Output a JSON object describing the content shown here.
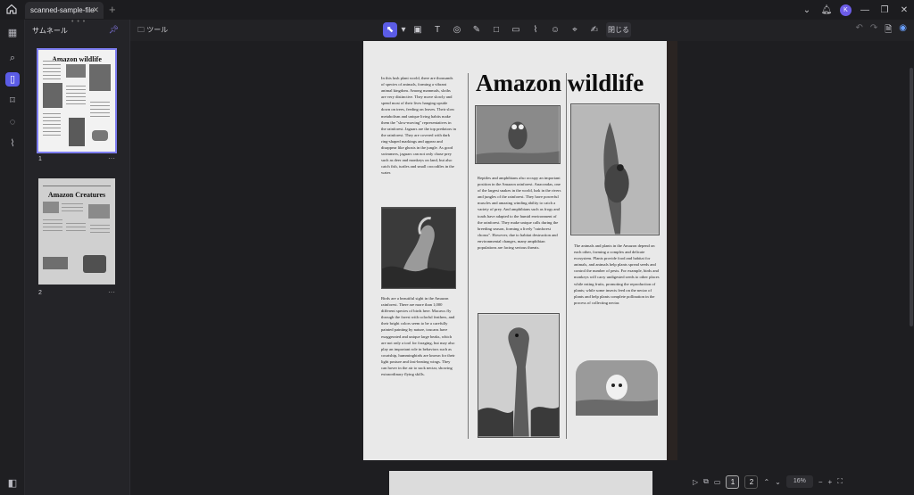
{
  "app": {
    "tab_title": "scanned-sample-file",
    "tab_close": "✕",
    "tab_add": "+",
    "avatar_initial": "K"
  },
  "sidebar": {
    "title": "サムネール",
    "pages": [
      {
        "number": "1",
        "heading": "Amazon wildlife",
        "selected": true
      },
      {
        "number": "2",
        "heading": "Amazon Creatures",
        "selected": false
      }
    ],
    "more": "···"
  },
  "toolbar": {
    "tool_label": "ツール",
    "close_label": "閉じる"
  },
  "document": {
    "title": "Amazon wildlife",
    "col1_top": "In this lush plant world, there are thousands of species of animals, forming a vibrant animal kingdom. Among mammals, sloths are very distinctive. They move slowly and spend most of their lives hanging upside down on trees, feeding on leaves. Their slow metabolism and unique living habits make them the \"slow-moving\" representatives in the rainforest. Jaguars are the top predators in the rainforest. They are covered with dark ring-shaped markings and appear and disappear like ghosts in the jungle. As good swimmers, jaguars can not only chase prey such as deer and monkeys on land, but also catch fish, turtles and small crocodiles in the water.",
    "col1_bottom": "Birds are a beautiful sight in the Amazon rainforest. There are more than 1,000 different species of birds here. Macaws fly through the forest with colorful feathers, and their bright colors seem to be a carefully painted painting by nature, toucans have exaggerated and unique large beaks, which are not only a tool for foraging, but may also play an important role in behaviors such as courtship, hummingbirds are known for their light posture and fast-beating wings. They can hover in the air to suck nectar, showing extraordinary flying skills.",
    "col2": "Reptiles and amphibians also occupy an important position in the Amazon rainforest. Anacondas, one of the largest snakes in the world, lurk in the rivers and jungles of the rainforest. They have powerful muscles and amazing winding ability to catch a variety of prey. And amphibians such as frogs and toads have adapted to the humid environment of the rainforest. They make unique calls during the breeding season, forming a lively \"rainforest chorus\". However, due to habitat destruction and environmental changes, many amphibian populations are facing serious threats.",
    "col3": "The animals and plants in the Amazon depend on each other, forming a complex and delicate ecosystem. Plants provide food and habitat for animals, and animals help plants spread seeds and control the number of pests. For example, birds and monkeys will carry undigested seeds to other places while eating fruits, promoting the reproduction of plants; while some insects feed on the nectar of plants and help plants complete pollination in the process of collecting nectar."
  },
  "status": {
    "pages": [
      "1",
      "2"
    ],
    "current_page": "1",
    "zoom": "16%",
    "minus": "−",
    "plus": "+"
  }
}
